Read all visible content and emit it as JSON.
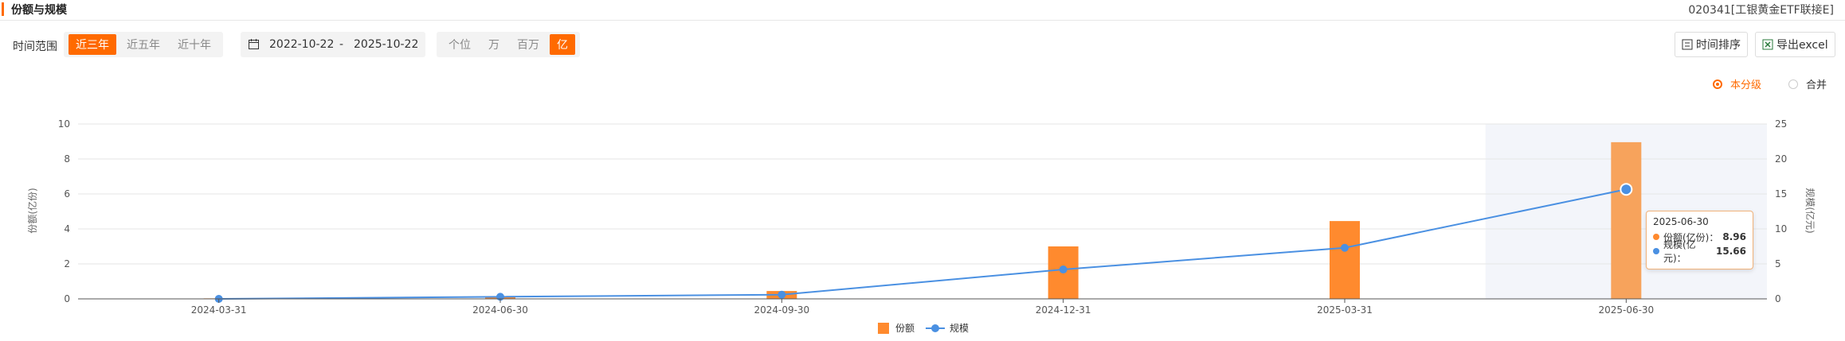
{
  "header": {
    "title": "份额与规模",
    "fund": "020341[工银黄金ETF联接E]"
  },
  "controls": {
    "range_label": "时间范围",
    "range_options": [
      "近三年",
      "近五年",
      "近十年"
    ],
    "range_selected": "近三年",
    "date_start": "2022-10-22",
    "date_sep": "-",
    "date_end": "2025-10-22",
    "unit_options": [
      "个位",
      "万",
      "百万",
      "亿"
    ],
    "unit_selected": "亿",
    "sort_button": "时间排序",
    "export_button": "导出excel"
  },
  "view_options": {
    "selected": "本分级",
    "options": [
      "本分级",
      "合并"
    ]
  },
  "colors": {
    "accent": "#ff6a00",
    "bar": "#ff8a2e",
    "bar_highlight": "#f7a35c",
    "line": "#4a90e2",
    "hover_band": "#f3f5fa"
  },
  "chart_data": {
    "type": "bar",
    "categories": [
      "2024-03-31",
      "2024-06-30",
      "2024-09-30",
      "2024-12-31",
      "2025-03-31",
      "2025-06-30"
    ],
    "series": [
      {
        "name": "份额",
        "type": "bar",
        "axis": "left",
        "values": [
          0.03,
          0.12,
          0.45,
          3.0,
          4.45,
          8.96
        ]
      },
      {
        "name": "规模",
        "type": "line",
        "axis": "right",
        "values": [
          0.0,
          0.3,
          0.6,
          4.2,
          7.3,
          15.66
        ]
      }
    ],
    "ylabel_left": "份额(亿份)",
    "ylabel_right": "规模(亿元)",
    "ylim_left": [
      0,
      10
    ],
    "yticks_left": [
      "0",
      "2",
      "4",
      "6",
      "8",
      "10"
    ],
    "ylim_right": [
      0,
      25
    ],
    "yticks_right": [
      "0",
      "5",
      "10",
      "15",
      "20",
      "25"
    ],
    "grid": true,
    "legend_position": "bottom-center",
    "highlighted_category": "2025-06-30",
    "tooltip": {
      "date": "2025-06-30",
      "rows": [
        {
          "label": "份额(亿份)：",
          "value": "8.96"
        },
        {
          "label": "规模(亿元)：",
          "value": "15.66"
        }
      ]
    }
  }
}
